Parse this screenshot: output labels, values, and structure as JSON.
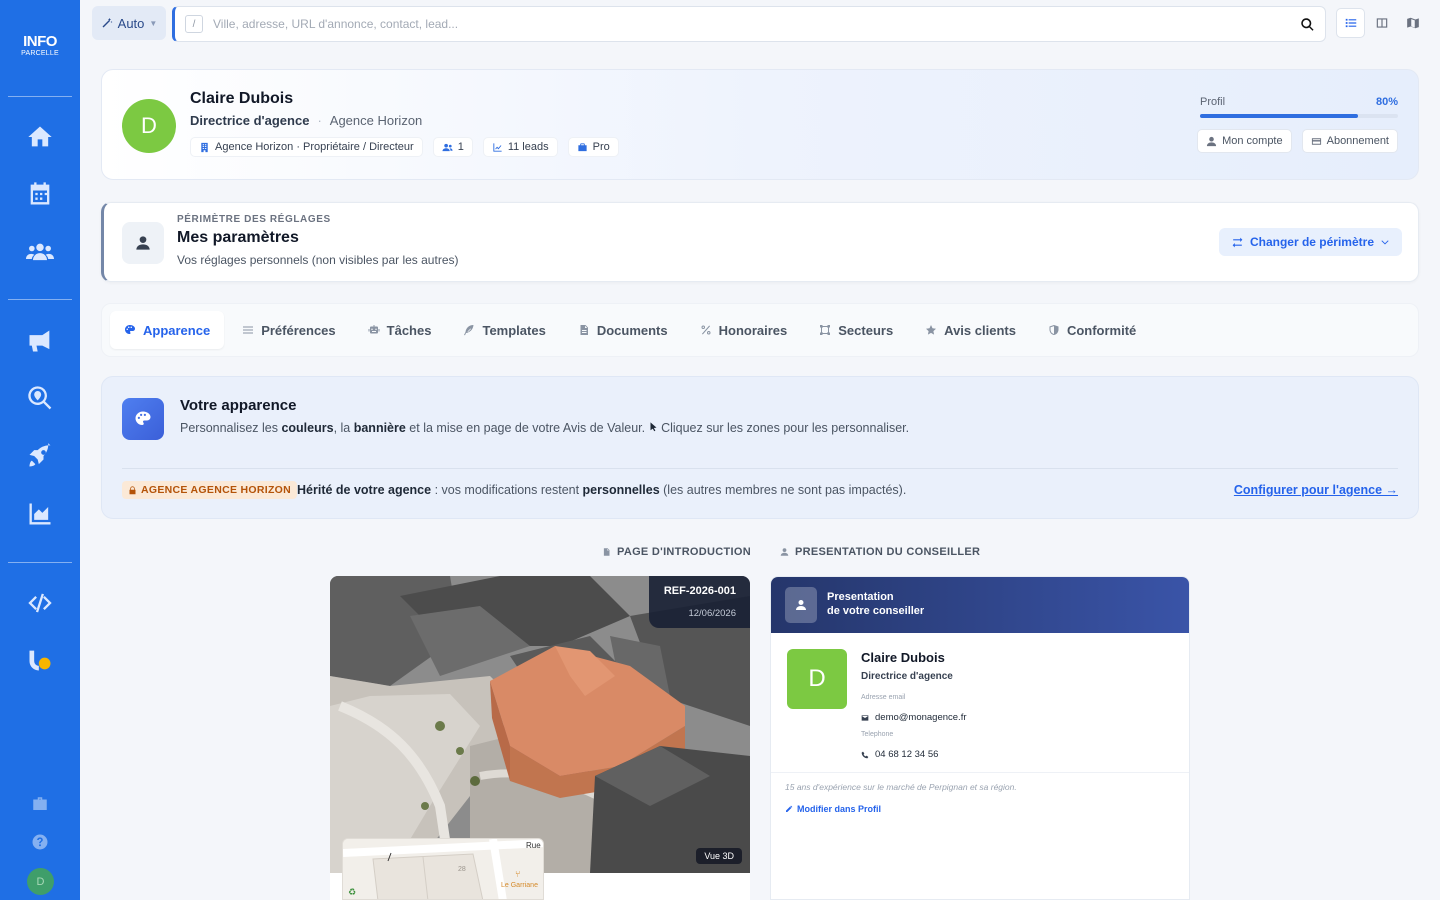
{
  "brand": {
    "logo_line1": "INFO",
    "logo_line2": "PARCELLE"
  },
  "topbar": {
    "mode_label": "Auto",
    "search_shortcut": "/",
    "search_placeholder": "Ville, adresse, URL d'annonce, contact, lead..."
  },
  "profile": {
    "avatar_letter": "D",
    "name": "Claire Dubois",
    "role": "Directrice d'agence",
    "separator": "·",
    "agency": "Agence Horizon",
    "chips": [
      {
        "icon": "building-icon",
        "label": "Agence Horizon · Propriétaire / Directeur"
      },
      {
        "icon": "users-icon",
        "label": "1"
      },
      {
        "icon": "chart-line-icon",
        "label": "11 leads"
      },
      {
        "icon": "briefcase-icon",
        "label": "Pro"
      }
    ],
    "progress_label": "Profil",
    "progress_value": "80%",
    "progress_fraction": 0.8,
    "btn_account": "Mon compte",
    "btn_subscription": "Abonnement"
  },
  "scope": {
    "kicker": "PÉRIMÈTRE DES RÉGLAGES",
    "title": "Mes paramètres",
    "subtitle": "Vos réglages personnels (non visibles par les autres)",
    "change_button": "Changer de périmètre"
  },
  "tabs": [
    {
      "label": "Apparence",
      "icon": "palette-icon",
      "active": true
    },
    {
      "label": "Préférences",
      "icon": "sliders-icon",
      "active": false
    },
    {
      "label": "Tâches",
      "icon": "robot-icon",
      "active": false
    },
    {
      "label": "Templates",
      "icon": "feather-icon",
      "active": false
    },
    {
      "label": "Documents",
      "icon": "file-icon",
      "active": false
    },
    {
      "label": "Honoraires",
      "icon": "percent-icon",
      "active": false
    },
    {
      "label": "Secteurs",
      "icon": "draw-polygon-icon",
      "active": false
    },
    {
      "label": "Avis clients",
      "icon": "star-icon",
      "active": false
    },
    {
      "label": "Conformité",
      "icon": "shield-icon",
      "active": false
    }
  ],
  "appearance": {
    "title": "Votre apparence",
    "desc_1": "Personnalisez les ",
    "desc_b1": "couleurs",
    "desc_2": ", la ",
    "desc_b2": "bannière",
    "desc_3": " et la mise en page de votre Avis de Valeur. ",
    "desc_4": "Cliquez sur les zones pour les personnaliser.",
    "badge": "AGENCE AGENCE HORIZON",
    "inherit_b1": "Hérité de votre agence",
    "inherit_2": " : vos modifications restent ",
    "inherit_b2": "personnelles",
    "inherit_3": " (les autres membres ne sont pas impactés).",
    "config_link": "Configurer pour l'agence →"
  },
  "sections": {
    "intro_label": "PAGE D'INTRODUCTION",
    "advisor_label": "PRESENTATION DU CONSEILLER"
  },
  "intro_preview": {
    "ref": "REF-2026-001",
    "date": "12/06/2026",
    "view_badge": "Vue 3D",
    "map_street": "Rue",
    "map_place": "Le Garriane",
    "map_number": "28"
  },
  "advisor_preview": {
    "head_line1": "Presentation",
    "head_line2": "de votre conseiller",
    "avatar_letter": "D",
    "name": "Claire Dubois",
    "role": "Directrice d'agence",
    "email_label": "Adresse email",
    "email": "demo@monagence.fr",
    "phone_label": "Telephone",
    "phone": "04 68 12 34 56",
    "bio": "15 ans d'expérience sur le marché de Perpignan et sa région.",
    "edit_link": "Modifier dans Profil"
  },
  "sidebar": {
    "user_avatar_letter": "D",
    "items": [
      {
        "name": "home-icon"
      },
      {
        "name": "calendar-icon"
      },
      {
        "name": "users-icon"
      },
      {
        "name": "megaphone-icon"
      },
      {
        "name": "search-location-icon"
      },
      {
        "name": "rocket-icon"
      },
      {
        "name": "chart-area-icon"
      },
      {
        "name": "code-icon"
      },
      {
        "name": "integration-icon"
      },
      {
        "name": "toolbox-icon"
      },
      {
        "name": "help-icon"
      }
    ]
  },
  "colors": {
    "sidebar": "#1f6fe5",
    "accent": "#2563eb",
    "avatar_green": "#7cc942",
    "badge_orange": "#b45309"
  }
}
